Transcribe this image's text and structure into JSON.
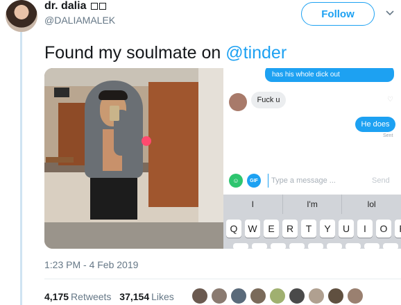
{
  "author": {
    "display_name": "dr. dalia",
    "handle": "@DALIAMALEK"
  },
  "follow_button": {
    "label": "Follow"
  },
  "tweet": {
    "text_prefix": "Found my soulmate on ",
    "mention": "@tinder"
  },
  "screenshot_chat": {
    "top_message": "has his whole dick out",
    "incoming_message": "Fuck u",
    "outgoing_message": "He does",
    "status": "Sent",
    "gif_label": "GIF",
    "input_placeholder": "Type a message ...",
    "send_label": "Send",
    "suggestions": [
      "I",
      "I'm",
      "lol"
    ],
    "keys_row1": [
      "Q",
      "W",
      "E",
      "R",
      "T",
      "Y",
      "U",
      "I",
      "O",
      "P"
    ]
  },
  "timestamp": "1:23 PM - 4 Feb 2019",
  "stats": {
    "retweets_count": "4,175",
    "retweets_label": "Retweets",
    "likes_count": "37,154",
    "likes_label": "Likes"
  },
  "likers": [
    {
      "color": "#6b5a50"
    },
    {
      "color": "#8a7a70"
    },
    {
      "color": "#5a6a7a"
    },
    {
      "color": "#7a6a5a"
    },
    {
      "color": "#a0b070"
    },
    {
      "color": "#4a4a4a"
    },
    {
      "color": "#b0a090"
    },
    {
      "color": "#605040"
    },
    {
      "color": "#9a8070"
    }
  ],
  "colors": {
    "accent": "#1da1f2",
    "text": "#14171a",
    "secondary_text": "#657786"
  }
}
